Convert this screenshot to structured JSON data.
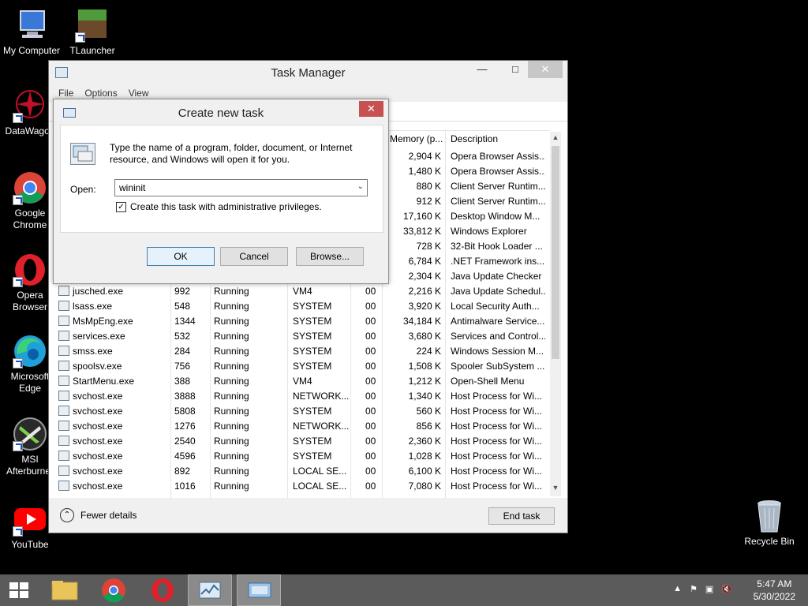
{
  "desktop": {
    "icons": [
      {
        "label": "My Computer"
      },
      {
        "label": "TLauncher"
      },
      {
        "label": "DataWagon"
      },
      {
        "label": "Google Chrome"
      },
      {
        "label": "Opera Browser"
      },
      {
        "label": "Microsoft Edge"
      },
      {
        "label": "MSI Afterburner"
      },
      {
        "label": "YouTube"
      },
      {
        "label": "Recycle Bin"
      }
    ]
  },
  "task_manager": {
    "title": "Task Manager",
    "menu": [
      "File",
      "Options",
      "View"
    ],
    "columns": {
      "memory": "Memory (p...",
      "description": "Description"
    },
    "rows": [
      {
        "name": "",
        "pid": "",
        "status": "",
        "user": "",
        "cpu": "",
        "memory": "2,904 K",
        "description": "Opera Browser Assis..."
      },
      {
        "name": "",
        "pid": "",
        "status": "",
        "user": "",
        "cpu": "",
        "memory": "1,480 K",
        "description": "Opera Browser Assis..."
      },
      {
        "name": "",
        "pid": "",
        "status": "",
        "user": "",
        "cpu": "",
        "memory": "880 K",
        "description": "Client Server Runtim..."
      },
      {
        "name": "",
        "pid": "",
        "status": "",
        "user": "",
        "cpu": "",
        "memory": "912 K",
        "description": "Client Server Runtim..."
      },
      {
        "name": "",
        "pid": "",
        "status": "",
        "user": "",
        "cpu": "",
        "memory": "17,160 K",
        "description": "Desktop Window M..."
      },
      {
        "name": "",
        "pid": "",
        "status": "",
        "user": "",
        "cpu": "",
        "memory": "33,812 K",
        "description": "Windows Explorer"
      },
      {
        "name": "",
        "pid": "",
        "status": "",
        "user": "",
        "cpu": "",
        "memory": "728 K",
        "description": "32-Bit Hook Loader ..."
      },
      {
        "name": "",
        "pid": "",
        "status": "",
        "user": "",
        "cpu": "",
        "memory": "6,784 K",
        "description": ".NET Framework ins..."
      },
      {
        "name": "",
        "pid": "",
        "status": "",
        "user": "",
        "cpu": "",
        "memory": "2,304 K",
        "description": "Java Update Checker"
      },
      {
        "name": "jusched.exe",
        "pid": "992",
        "status": "Running",
        "user": "VM4",
        "cpu": "00",
        "memory": "2,216 K",
        "description": "Java Update Schedul..."
      },
      {
        "name": "lsass.exe",
        "pid": "548",
        "status": "Running",
        "user": "SYSTEM",
        "cpu": "00",
        "memory": "3,920 K",
        "description": "Local Security Auth..."
      },
      {
        "name": "MsMpEng.exe",
        "pid": "1344",
        "status": "Running",
        "user": "SYSTEM",
        "cpu": "00",
        "memory": "34,184 K",
        "description": "Antimalware Service..."
      },
      {
        "name": "services.exe",
        "pid": "532",
        "status": "Running",
        "user": "SYSTEM",
        "cpu": "00",
        "memory": "3,680 K",
        "description": "Services and Control..."
      },
      {
        "name": "smss.exe",
        "pid": "284",
        "status": "Running",
        "user": "SYSTEM",
        "cpu": "00",
        "memory": "224 K",
        "description": "Windows Session M..."
      },
      {
        "name": "spoolsv.exe",
        "pid": "756",
        "status": "Running",
        "user": "SYSTEM",
        "cpu": "00",
        "memory": "1,508 K",
        "description": "Spooler SubSystem ..."
      },
      {
        "name": "StartMenu.exe",
        "pid": "388",
        "status": "Running",
        "user": "VM4",
        "cpu": "00",
        "memory": "1,212 K",
        "description": "Open-Shell Menu"
      },
      {
        "name": "svchost.exe",
        "pid": "3888",
        "status": "Running",
        "user": "NETWORK...",
        "cpu": "00",
        "memory": "1,340 K",
        "description": "Host Process for Wi..."
      },
      {
        "name": "svchost.exe",
        "pid": "5808",
        "status": "Running",
        "user": "SYSTEM",
        "cpu": "00",
        "memory": "560 K",
        "description": "Host Process for Wi..."
      },
      {
        "name": "svchost.exe",
        "pid": "1276",
        "status": "Running",
        "user": "NETWORK...",
        "cpu": "00",
        "memory": "856 K",
        "description": "Host Process for Wi..."
      },
      {
        "name": "svchost.exe",
        "pid": "2540",
        "status": "Running",
        "user": "SYSTEM",
        "cpu": "00",
        "memory": "2,360 K",
        "description": "Host Process for Wi..."
      },
      {
        "name": "svchost.exe",
        "pid": "4596",
        "status": "Running",
        "user": "SYSTEM",
        "cpu": "00",
        "memory": "1,028 K",
        "description": "Host Process for Wi..."
      },
      {
        "name": "svchost.exe",
        "pid": "892",
        "status": "Running",
        "user": "LOCAL SE...",
        "cpu": "00",
        "memory": "6,100 K",
        "description": "Host Process for Wi..."
      },
      {
        "name": "svchost.exe",
        "pid": "1016",
        "status": "Running",
        "user": "LOCAL SE...",
        "cpu": "00",
        "memory": "7,080 K",
        "description": "Host Process for Wi..."
      }
    ],
    "fewer_details": "Fewer details",
    "end_task": "End task"
  },
  "dialog": {
    "title": "Create new task",
    "message": "Type the name of a program, folder, document, or Internet resource, and Windows will open it for you.",
    "open_label": "Open:",
    "open_value": "wininit",
    "admin_label": "Create this task with administrative privileges.",
    "admin_checked": true,
    "ok": "OK",
    "cancel": "Cancel",
    "browse": "Browse..."
  },
  "taskbar": {
    "time": "5:47 AM",
    "date": "5/30/2022"
  },
  "colors": {
    "close_red": "#c75050",
    "taskbar": "#5b5b5b",
    "desktop": "#000000"
  }
}
